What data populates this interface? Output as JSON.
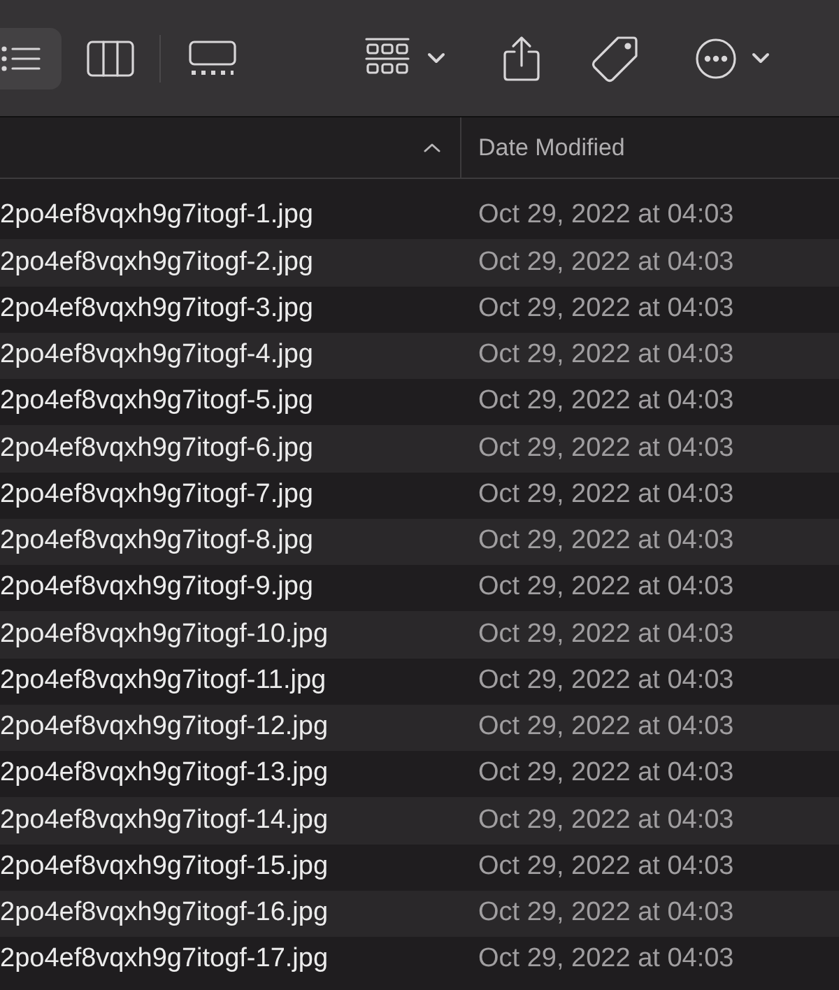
{
  "toolbar": {
    "view_modes": [
      {
        "kind": "list",
        "selected": true
      },
      {
        "kind": "columns",
        "selected": false
      },
      {
        "kind": "gallery",
        "selected": false
      }
    ]
  },
  "table": {
    "columns": [
      {
        "label": "Date Modified"
      }
    ],
    "rows": [
      {
        "name": "2po4ef8vqxh9g7itogf-1.jpg",
        "date": "Oct 29, 2022 at 04:03"
      },
      {
        "name": "2po4ef8vqxh9g7itogf-2.jpg",
        "date": "Oct 29, 2022 at 04:03"
      },
      {
        "name": "2po4ef8vqxh9g7itogf-3.jpg",
        "date": "Oct 29, 2022 at 04:03"
      },
      {
        "name": "2po4ef8vqxh9g7itogf-4.jpg",
        "date": "Oct 29, 2022 at 04:03"
      },
      {
        "name": "2po4ef8vqxh9g7itogf-5.jpg",
        "date": "Oct 29, 2022 at 04:03"
      },
      {
        "name": "2po4ef8vqxh9g7itogf-6.jpg",
        "date": "Oct 29, 2022 at 04:03"
      },
      {
        "name": "2po4ef8vqxh9g7itogf-7.jpg",
        "date": "Oct 29, 2022 at 04:03"
      },
      {
        "name": "2po4ef8vqxh9g7itogf-8.jpg",
        "date": "Oct 29, 2022 at 04:03"
      },
      {
        "name": "2po4ef8vqxh9g7itogf-9.jpg",
        "date": "Oct 29, 2022 at 04:03"
      },
      {
        "name": "2po4ef8vqxh9g7itogf-10.jpg",
        "date": "Oct 29, 2022 at 04:03"
      },
      {
        "name": "2po4ef8vqxh9g7itogf-11.jpg",
        "date": "Oct 29, 2022 at 04:03"
      },
      {
        "name": "2po4ef8vqxh9g7itogf-12.jpg",
        "date": "Oct 29, 2022 at 04:03"
      },
      {
        "name": "2po4ef8vqxh9g7itogf-13.jpg",
        "date": "Oct 29, 2022 at 04:03"
      },
      {
        "name": "2po4ef8vqxh9g7itogf-14.jpg",
        "date": "Oct 29, 2022 at 04:03"
      },
      {
        "name": "2po4ef8vqxh9g7itogf-15.jpg",
        "date": "Oct 29, 2022 at 04:03"
      },
      {
        "name": "2po4ef8vqxh9g7itogf-16.jpg",
        "date": "Oct 29, 2022 at 04:03"
      },
      {
        "name": "2po4ef8vqxh9g7itogf-17.jpg",
        "date": "Oct 29, 2022 at 04:03"
      }
    ]
  }
}
